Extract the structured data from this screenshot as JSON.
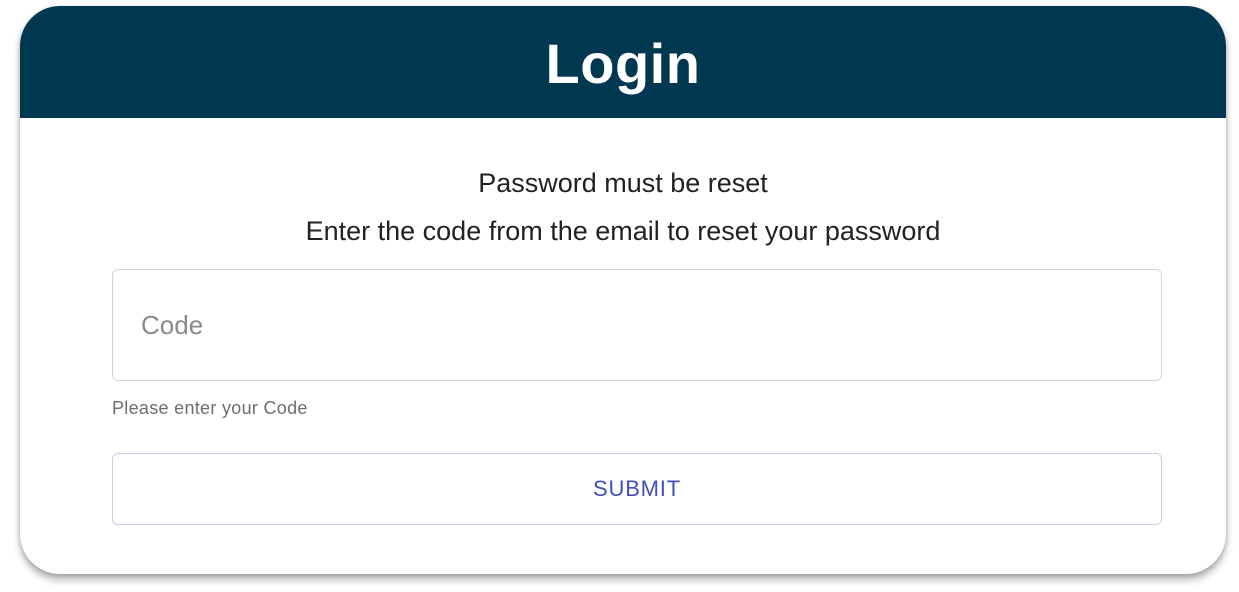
{
  "login": {
    "title": "Login",
    "message_line1": "Password must be reset",
    "message_line2": "Enter the code from the email to reset your password",
    "code_field": {
      "value": "",
      "placeholder": "Code",
      "helper_text": "Please enter your Code"
    },
    "submit_label": "SUBMIT"
  },
  "colors": {
    "header_background": "#003751",
    "header_text": "#ffffff",
    "button_text": "#3f51b5",
    "helper_text": "#6e6e6e"
  }
}
